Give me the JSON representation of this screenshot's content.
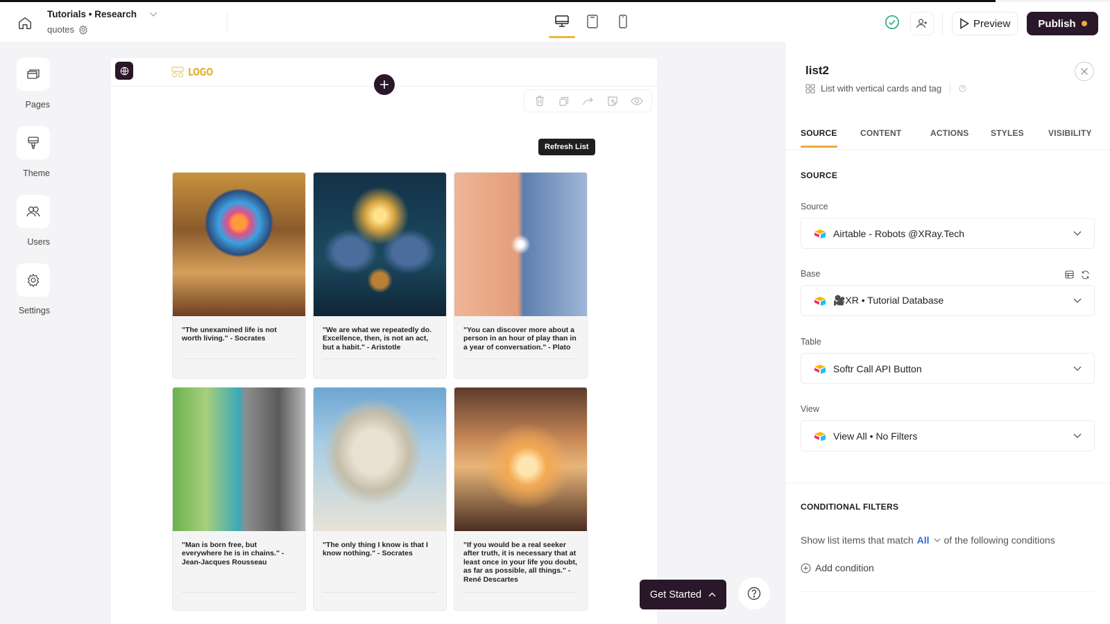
{
  "header": {
    "project_title": "Tutorials • Research",
    "page_name": "quotes",
    "devices": [
      {
        "name": "desktop",
        "active": true
      },
      {
        "name": "tablet",
        "active": false
      },
      {
        "name": "mobile",
        "active": false
      }
    ],
    "preview_label": "Preview",
    "publish_label": "Publish",
    "colors": {
      "accent": "#f0a83c",
      "brand_dark": "#2a1729",
      "success": "#2faa7b"
    }
  },
  "leftnav": {
    "items": [
      {
        "label": "Pages",
        "icon": "pages-icon"
      },
      {
        "label": "Theme",
        "icon": "paint-roller-icon"
      },
      {
        "label": "Users",
        "icon": "users-icon"
      },
      {
        "label": "Settings",
        "icon": "gear-icon"
      }
    ]
  },
  "canvas": {
    "logo_text": "LOGO",
    "refresh_label": "Refresh List",
    "toolbar": [
      "delete-icon",
      "duplicate-icon",
      "move-icon",
      "add-to-library-icon",
      "visibility-icon"
    ],
    "cards": [
      {
        "quote": "\"The unexamined life is not worth living.\" - Socrates"
      },
      {
        "quote": "\"We are what we repeatedly do. Excellence, then, is not an act, but a habit.\" - Aristotle"
      },
      {
        "quote": "\"You can discover more about a person in an hour of play than in a year of conversation.\" - Plato"
      },
      {
        "quote": "\"Man is born free, but everywhere he is in chains.\" - Jean-Jacques Rousseau"
      },
      {
        "quote": "\"The only thing I know is that I know nothing.\" - Socrates"
      },
      {
        "quote": "\"If you would be a real seeker after truth, it is necessary that at least once in your life you doubt, as far as possible, all things.\" - René Descartes"
      }
    ]
  },
  "floating": {
    "get_started_label": "Get Started"
  },
  "panel": {
    "title": "list2",
    "subtitle": "List with vertical cards and tag",
    "tabs": [
      {
        "label": "SOURCE",
        "active": true
      },
      {
        "label": "CONTENT",
        "active": false
      },
      {
        "label": "ACTIONS",
        "active": false
      },
      {
        "label": "STYLES",
        "active": false
      },
      {
        "label": "VISIBILITY",
        "active": false
      }
    ],
    "source_section_title": "SOURCE",
    "fields": {
      "source": {
        "label": "Source",
        "value": "Airtable - Robots @XRay.Tech"
      },
      "base": {
        "label": "Base",
        "value": "🎥XR • Tutorial Database"
      },
      "table": {
        "label": "Table",
        "value": "Softr Call API Button"
      },
      "view": {
        "label": "View",
        "value": "View All • No Filters"
      }
    },
    "conditional": {
      "title": "CONDITIONAL FILTERS",
      "prefix": "Show list items that match",
      "match": "All",
      "suffix": "of the following conditions",
      "add_label": "Add condition"
    }
  }
}
